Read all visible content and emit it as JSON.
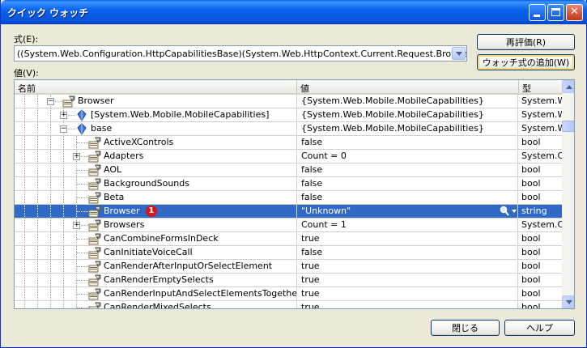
{
  "window": {
    "title": "クイック ウォッチ"
  },
  "expression": {
    "label": "式(E):",
    "value": "((System.Web.Configuration.HttpCapabilitiesBase)(System.Web.HttpContext.Current.Request.Browser)).Browser"
  },
  "buttons": {
    "reevaluate": "再評価(R)",
    "add_watch": "ウォッチ式の追加(W)",
    "close": "閉じる",
    "help": "ヘルプ"
  },
  "values_label": "値(V):",
  "grid": {
    "columns": [
      "名前",
      "値",
      "型"
    ],
    "rows": [
      {
        "name": "Browser",
        "value": "{System.Web.Mobile.MobileCapabilities}",
        "type": "System.Web.Mobile",
        "level": 3,
        "expander": "minus",
        "icon": "property-icon"
      },
      {
        "name": "[System.Web.Mobile.MobileCapabilities]",
        "value": "{System.Web.Mobile.MobileCapabilities}",
        "type": "System.Web.Mobile",
        "level": 4,
        "expander": "plus",
        "icon": "class-icon"
      },
      {
        "name": "base",
        "value": "{System.Web.Mobile.MobileCapabilities}",
        "type": "System.Web.Mobile",
        "level": 4,
        "expander": "minus",
        "icon": "class-icon"
      },
      {
        "name": "ActiveXControls",
        "value": "false",
        "type": "bool",
        "level": 5,
        "expander": "",
        "icon": "property-icon"
      },
      {
        "name": "Adapters",
        "value": "Count = 0",
        "type": "System.Collections",
        "level": 5,
        "expander": "plus",
        "icon": "property-icon"
      },
      {
        "name": "AOL",
        "value": "false",
        "type": "bool",
        "level": 5,
        "expander": "",
        "icon": "property-icon"
      },
      {
        "name": "BackgroundSounds",
        "value": "false",
        "type": "bool",
        "level": 5,
        "expander": "",
        "icon": "property-icon"
      },
      {
        "name": "Beta",
        "value": "false",
        "type": "bool",
        "level": 5,
        "expander": "",
        "icon": "property-icon"
      },
      {
        "name": "Browser",
        "value": "\"Unknown\"",
        "type": "string",
        "level": 5,
        "expander": "",
        "icon": "property-icon",
        "selected": true,
        "badge": "1"
      },
      {
        "name": "Browsers",
        "value": "Count = 1",
        "type": "System.Collections",
        "level": 5,
        "expander": "plus",
        "icon": "property-icon"
      },
      {
        "name": "CanCombineFormsInDeck",
        "value": "true",
        "type": "bool",
        "level": 5,
        "expander": "",
        "icon": "property-icon"
      },
      {
        "name": "CanInitiateVoiceCall",
        "value": "false",
        "type": "bool",
        "level": 5,
        "expander": "",
        "icon": "property-icon"
      },
      {
        "name": "CanRenderAfterInputOrSelectElement",
        "value": "true",
        "type": "bool",
        "level": 5,
        "expander": "",
        "icon": "property-icon"
      },
      {
        "name": "CanRenderEmptySelects",
        "value": "true",
        "type": "bool",
        "level": 5,
        "expander": "",
        "icon": "property-icon"
      },
      {
        "name": "CanRenderInputAndSelectElementsTogether",
        "value": "true",
        "type": "bool",
        "level": 5,
        "expander": "",
        "icon": "property-icon"
      },
      {
        "name": "CanRenderMixedSelects",
        "value": "true",
        "type": "bool",
        "level": 5,
        "expander": "",
        "icon": "property-icon"
      }
    ]
  },
  "colors": {
    "selection": "#316ac5",
    "titlebar": "#0a64ee"
  }
}
